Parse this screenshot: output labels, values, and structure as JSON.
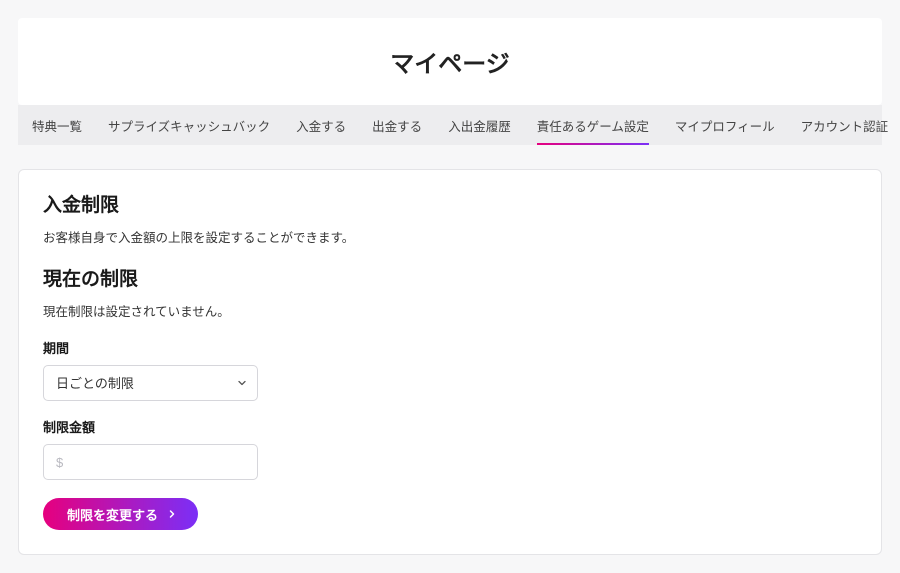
{
  "header": {
    "title": "マイページ"
  },
  "tabs": {
    "items": [
      {
        "label": "特典一覧"
      },
      {
        "label": "サプライズキャッシュバック"
      },
      {
        "label": "入金する"
      },
      {
        "label": "出金する"
      },
      {
        "label": "入出金履歴"
      },
      {
        "label": "責任あるゲーム設定"
      },
      {
        "label": "マイプロフィール"
      },
      {
        "label": "アカウント認証"
      }
    ],
    "activeIndex": 5
  },
  "depositLimit": {
    "heading": "入金制限",
    "description": "お客様自身で入金額の上限を設定することができます。",
    "currentHeading": "現在の制限",
    "currentDescription": "現在制限は設定されていません。",
    "periodLabel": "期間",
    "periodSelected": "日ごとの制限",
    "amountLabel": "制限金額",
    "amountPlaceholder": "$",
    "buttonLabel": "制限を変更する"
  }
}
